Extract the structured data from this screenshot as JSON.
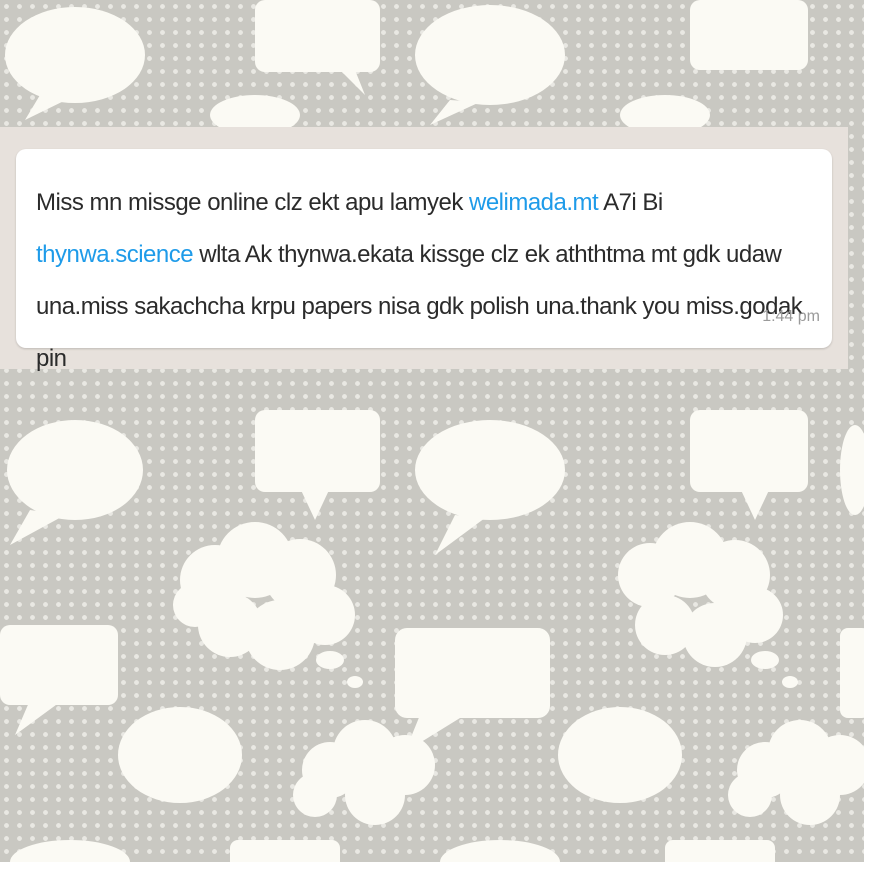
{
  "message": {
    "part1": "Miss mn missge online clz ekt apu lamyek ",
    "link1": "welimada.mt",
    "part2": " A7i Bi ",
    "link2": "thynwa.science",
    "part3": " wlta Ak thynwa.ekata kissge clz ek aththtma mt gdk udaw una.miss sakachcha krpu papers nisa gdk polish una.thank you miss.godak pin",
    "time": "1:44 pm"
  },
  "colors": {
    "link": "#1e9be9",
    "wallpaper": "#c9c8c2",
    "bubble": "#ffffff",
    "chat_strip": "#e7e1dc"
  }
}
